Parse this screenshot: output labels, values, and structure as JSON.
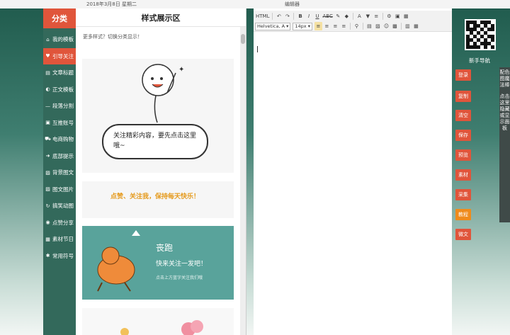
{
  "topbar": {
    "date": "2018年3月8日 星期二",
    "editor_title": "编辑器"
  },
  "categories": {
    "header": "分类",
    "items": [
      {
        "label": "我的模板",
        "icon": "home-icon"
      },
      {
        "label": "引导关注",
        "icon": "heart-icon",
        "active": true
      },
      {
        "label": "文章标题",
        "icon": "document-icon"
      },
      {
        "label": "正文模板",
        "icon": "circle-icon"
      },
      {
        "label": "段落分割",
        "icon": "dash-icon"
      },
      {
        "label": "互推账号",
        "icon": "account-icon"
      },
      {
        "label": "电商购物",
        "icon": "cart-icon"
      },
      {
        "label": "底部提示",
        "icon": "arrow-icon"
      },
      {
        "label": "背景图文",
        "icon": "image-icon"
      },
      {
        "label": "图文图片",
        "icon": "image-icon"
      },
      {
        "label": "搞笑动图",
        "icon": "refresh-icon"
      },
      {
        "label": "点赞分享",
        "icon": "share-icon"
      },
      {
        "label": "素材节日",
        "icon": "calendar-icon"
      },
      {
        "label": "常用符号",
        "icon": "symbol-icon"
      }
    ]
  },
  "style_panel": {
    "title": "样式展示区",
    "hint": "更多样式？切换分类显示！",
    "cards": {
      "follow_text": "关注精彩内容，要先点击这里哦~",
      "banner_text": "点赞、关注我，保持每天快乐！",
      "runner_title": "丧跑",
      "runner_sub": "快来关注一发吧！",
      "runner_small": "点击上方蓝字关注我们哦"
    }
  },
  "editor": {
    "font_family": "Helvetica, A",
    "font_size": "14px",
    "toolbar_row1": [
      "HTML",
      "↶",
      "↷",
      "B",
      "I",
      "U",
      "ABC",
      "✎",
      "◆",
      "A",
      "▼",
      "≡",
      "⚙",
      "▣",
      "▦"
    ],
    "toolbar_row2": [
      "≡",
      "≡",
      "≡",
      "≡",
      "⚲",
      "▤",
      "▨",
      "☺",
      "▩",
      "▥",
      "▦"
    ]
  },
  "right_panel": {
    "nav_title": "新手导航",
    "actions": [
      {
        "label": "登录",
        "color": "#e0553b"
      },
      {
        "label": "复制",
        "color": "#e0553b"
      },
      {
        "label": "清空",
        "color": "#e0553b"
      },
      {
        "label": "保存",
        "color": "#e0553b"
      },
      {
        "label": "预览",
        "color": "#e0553b"
      },
      {
        "label": "素材",
        "color": "#e0553b"
      },
      {
        "label": "采集",
        "color": "#e0553b"
      },
      {
        "label": "教程",
        "color": "#ef8b1c"
      },
      {
        "label": "微文",
        "color": "#e0553b"
      }
    ],
    "side_tab_top": "配色图魔法棒",
    "side_tab_bottom": "点击这里隐藏或显示面板"
  }
}
